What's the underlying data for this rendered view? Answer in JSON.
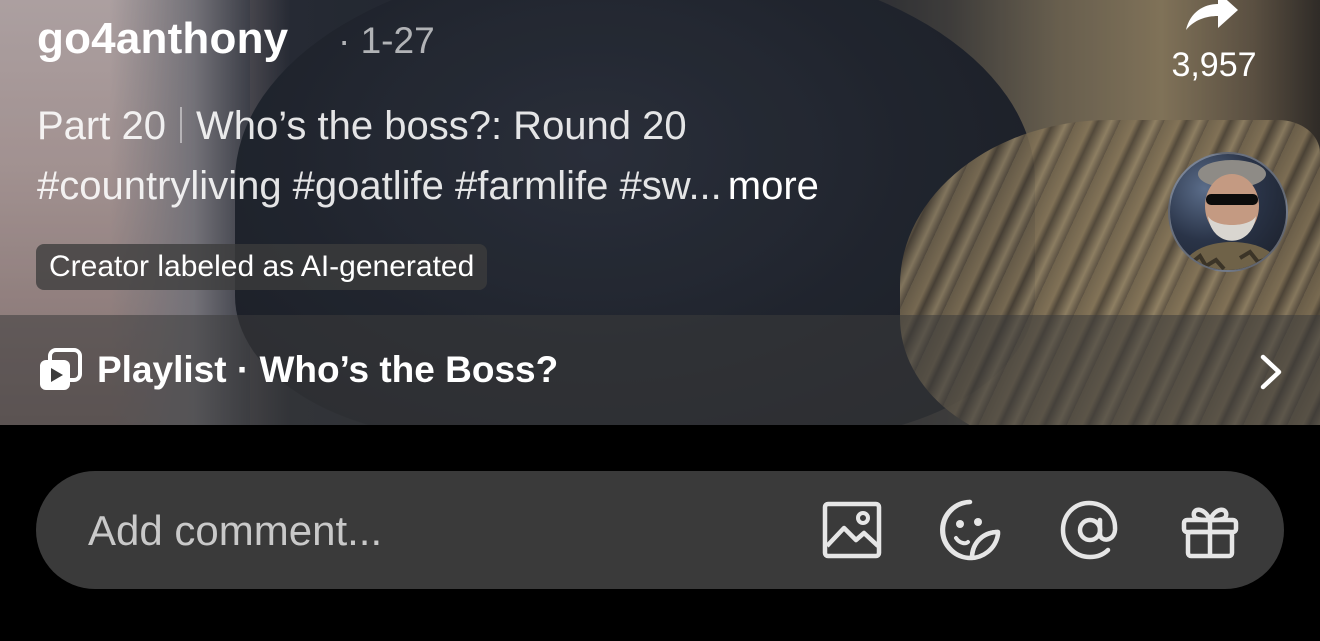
{
  "post": {
    "username": "go4anthony",
    "date": "· 1-27",
    "caption_part": "Part 20",
    "caption_title": "Who’s the boss?: Round 20",
    "caption_tags": "#countryliving #goatlife #farmlife #sw...",
    "more_label": "more",
    "ai_label": "Creator labeled as AI-generated"
  },
  "actions": {
    "share_count": "3,957",
    "share_icon": "share-arrow-icon",
    "avatar_icon": "creator-avatar"
  },
  "playlist": {
    "label": "Playlist · Who’s the Boss?",
    "icon": "playlist-icon",
    "chevron_icon": "chevron-right-icon"
  },
  "comment": {
    "placeholder": "Add comment...",
    "icons": [
      "image-icon",
      "sticker-icon",
      "mention-icon",
      "gift-icon"
    ]
  },
  "colors": {
    "background": "#000000",
    "comment_bar": "#3a3a3a",
    "playlist_bar": "#3c3c3c"
  }
}
